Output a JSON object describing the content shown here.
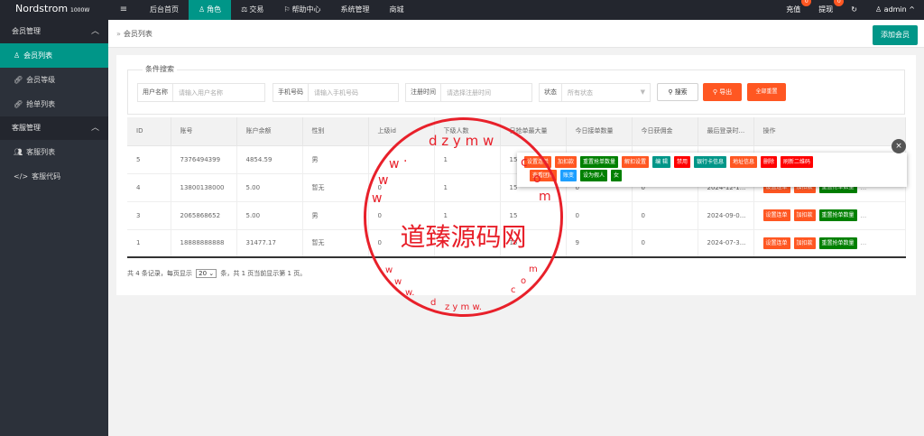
{
  "topbar": {
    "brand": "Nordstrom",
    "brand_sup": "1000W",
    "menu_icon": "≡",
    "nav": [
      {
        "label": "后台首页",
        "icon": ""
      },
      {
        "label": "角色",
        "icon": "♙"
      },
      {
        "label": "交易",
        "icon": "⚖"
      },
      {
        "label": "帮助中心",
        "icon": "⚐"
      },
      {
        "label": "系统管理",
        "icon": ""
      },
      {
        "label": "商城",
        "icon": ""
      }
    ],
    "recharge": {
      "label": "充值",
      "badge": "0"
    },
    "withdraw": {
      "label": "提现",
      "badge": "0"
    },
    "refresh_icon": "↻",
    "user": {
      "icon": "♙",
      "name": "admin",
      "caret": "^"
    }
  },
  "sidebar": {
    "groups": [
      {
        "label": "会员管理",
        "items": [
          {
            "label": "会员列表",
            "icon": "♙"
          },
          {
            "label": "会员等级",
            "icon": "🔗"
          },
          {
            "label": "抢单列表",
            "icon": "🔗"
          }
        ]
      },
      {
        "label": "客服管理",
        "items": [
          {
            "label": "客服列表",
            "icon": "👥"
          },
          {
            "label": "客服代码",
            "icon": "</>"
          }
        ]
      }
    ]
  },
  "header": {
    "breadcrumb": "会员列表",
    "sep": "»",
    "add_button": "添加会员"
  },
  "search": {
    "legend": "条件搜索",
    "username_label": "用户名称",
    "username_placeholder": "请输入用户名称",
    "phone_label": "手机号码",
    "phone_placeholder": "请输入手机号码",
    "regtime_label": "注册时间",
    "regtime_placeholder": "请选择注册时间",
    "status_label": "状态",
    "status_value": "所有状态",
    "search_button": "搜索",
    "export_button": "导出",
    "reset_button": "全部重置"
  },
  "table": {
    "columns": [
      "ID",
      "账号",
      "账户余额",
      "性别",
      "上级id",
      "下级人数",
      "日抢单最大量",
      "今日接单数量",
      "今日获佣金",
      "最后登录时...",
      "操作"
    ],
    "rows": [
      {
        "id": "5",
        "account": "7376494399",
        "balance": "4854.59",
        "gender": "男",
        "parent": "",
        "sub": "1",
        "max": "15",
        "today_orders": "",
        "today_comm": "",
        "last_login": ""
      },
      {
        "id": "4",
        "account": "13800138000",
        "balance": "5.00",
        "gender": "暂无",
        "parent": "0",
        "sub": "1",
        "max": "15",
        "today_orders": "0",
        "today_comm": "0",
        "last_login": "2024-12-1..."
      },
      {
        "id": "3",
        "account": "2065868652",
        "balance": "5.00",
        "gender": "男",
        "parent": "0",
        "sub": "1",
        "max": "15",
        "today_orders": "0",
        "today_comm": "0",
        "last_login": "2024-09-0..."
      },
      {
        "id": "1",
        "account": "18888888888",
        "balance": "31477.17",
        "gender": "暂无",
        "parent": "0",
        "sub": "",
        "max": "15",
        "today_orders": "9",
        "today_comm": "0",
        "last_login": "2024-07-3..."
      }
    ],
    "ops": [
      "设置连单",
      "加扣款",
      "重置抢单数量",
      "..."
    ]
  },
  "popup": {
    "row1": [
      {
        "label": "设置连单",
        "color": "o"
      },
      {
        "label": "加扣款",
        "color": "o"
      },
      {
        "label": "重置抢单数量",
        "color": "gr"
      },
      {
        "label": "解扣设置",
        "color": "o"
      },
      {
        "label": "编 辑",
        "color": "g"
      },
      {
        "label": "禁用",
        "color": "r"
      },
      {
        "label": "银行卡信息",
        "color": "g"
      },
      {
        "label": "地址信息",
        "color": "o"
      },
      {
        "label": "删除",
        "color": "r"
      },
      {
        "label": "刷新二维码",
        "color": "r"
      }
    ],
    "row2": [
      {
        "label": "查看团队",
        "color": "o"
      },
      {
        "label": "账变",
        "color": "b"
      },
      {
        "label": "设为假人",
        "color": "gr"
      },
      {
        "label": "女",
        "color": "gr"
      }
    ],
    "close": "×"
  },
  "pager": {
    "text1": "共 4 条记录，每页显示",
    "page_size": "20",
    "text2": "条，共 1 页当前显示第 1 页。"
  },
  "watermark": {
    "text": "道臻源码网",
    "domain": "www.dzymw.com"
  }
}
